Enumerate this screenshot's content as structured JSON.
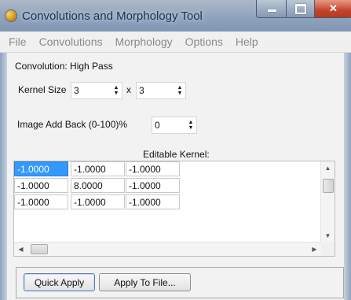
{
  "window": {
    "title": "Convolutions and Morphology Tool"
  },
  "menu": [
    "File",
    "Convolutions",
    "Morphology",
    "Options",
    "Help"
  ],
  "convolution": {
    "label": "Convolution: High Pass"
  },
  "kernel_size": {
    "label": "Kernel Size",
    "width": "3",
    "times": "x",
    "height": "3"
  },
  "image_add_back": {
    "label": "Image Add Back (0-100)%",
    "value": "0"
  },
  "editable_kernel": {
    "label": "Editable Kernel:",
    "rows": [
      [
        "-1.0000",
        "-1.0000",
        "-1.0000"
      ],
      [
        "-1.0000",
        "8.0000",
        "-1.0000"
      ],
      [
        "-1.0000",
        "-1.0000",
        "-1.0000"
      ]
    ]
  },
  "buttons": {
    "quick_apply": "Quick Apply",
    "apply_to_file": "Apply To File..."
  }
}
